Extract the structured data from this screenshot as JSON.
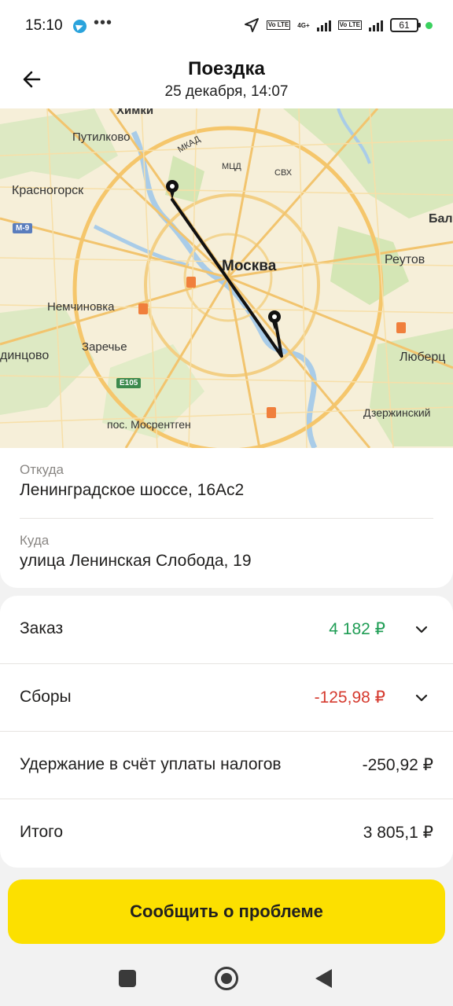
{
  "status_bar": {
    "time": "15:10",
    "icons": [
      "telegram-icon",
      "more-dots-icon",
      "navigation-icon",
      "volte-icon",
      "signal-icon",
      "volte-icon",
      "signal-icon",
      "battery-icon"
    ],
    "volte_label": "Vo LTE",
    "network_label": "4G+",
    "battery_level": "61",
    "more_label": "•••"
  },
  "header": {
    "title": "Поездка",
    "subtitle": "25 декабря, 14:07",
    "back_icon": "arrow-left-icon"
  },
  "map": {
    "labels": {
      "khimki": "Химки",
      "putilkovo": "Путилково",
      "krasnogorsk": "Красногорск",
      "moskva": "Москва",
      "nemchinovka": "Немчиновка",
      "zarechye": "Заречье",
      "odintsovo": "динцово",
      "mosrentgen": "пос. Мосрентген",
      "reutov": "Реутов",
      "lyubertsy": "Люберц",
      "dzerzhinsky": "Дзержинский",
      "bal": "Бал",
      "mkad": "МКАД",
      "mtsd": "МЦД",
      "skh": "СВХ",
      "m9": "М-9",
      "e105": "Е105"
    },
    "route_color": "#111111",
    "pins": [
      "start-pin",
      "end-pin"
    ]
  },
  "addresses": {
    "from_label": "Откуда",
    "from_value": "Ленинградское шоссе, 16Ас2",
    "to_label": "Куда",
    "to_value": "улица Ленинская Слобода, 19"
  },
  "finance": {
    "rows": [
      {
        "label": "Заказ",
        "amount": "4 182 ₽",
        "color": "#1f9d55",
        "expandable": true
      },
      {
        "label": "Сборы",
        "amount": "-125,98 ₽",
        "color": "#d53a2e",
        "expandable": true
      },
      {
        "label": "Удержание в счёт уплаты налогов",
        "amount": "-250,92 ₽",
        "color": "#21201f",
        "expandable": false
      },
      {
        "label": "Итого",
        "amount": "3 805,1 ₽",
        "color": "#21201f",
        "expandable": false
      }
    ]
  },
  "action": {
    "report_button": "Сообщить о проблеме",
    "accent": "#fce000"
  },
  "navbar": {
    "icons": [
      "recents-square-icon",
      "home-circle-icon",
      "back-triangle-icon"
    ]
  }
}
